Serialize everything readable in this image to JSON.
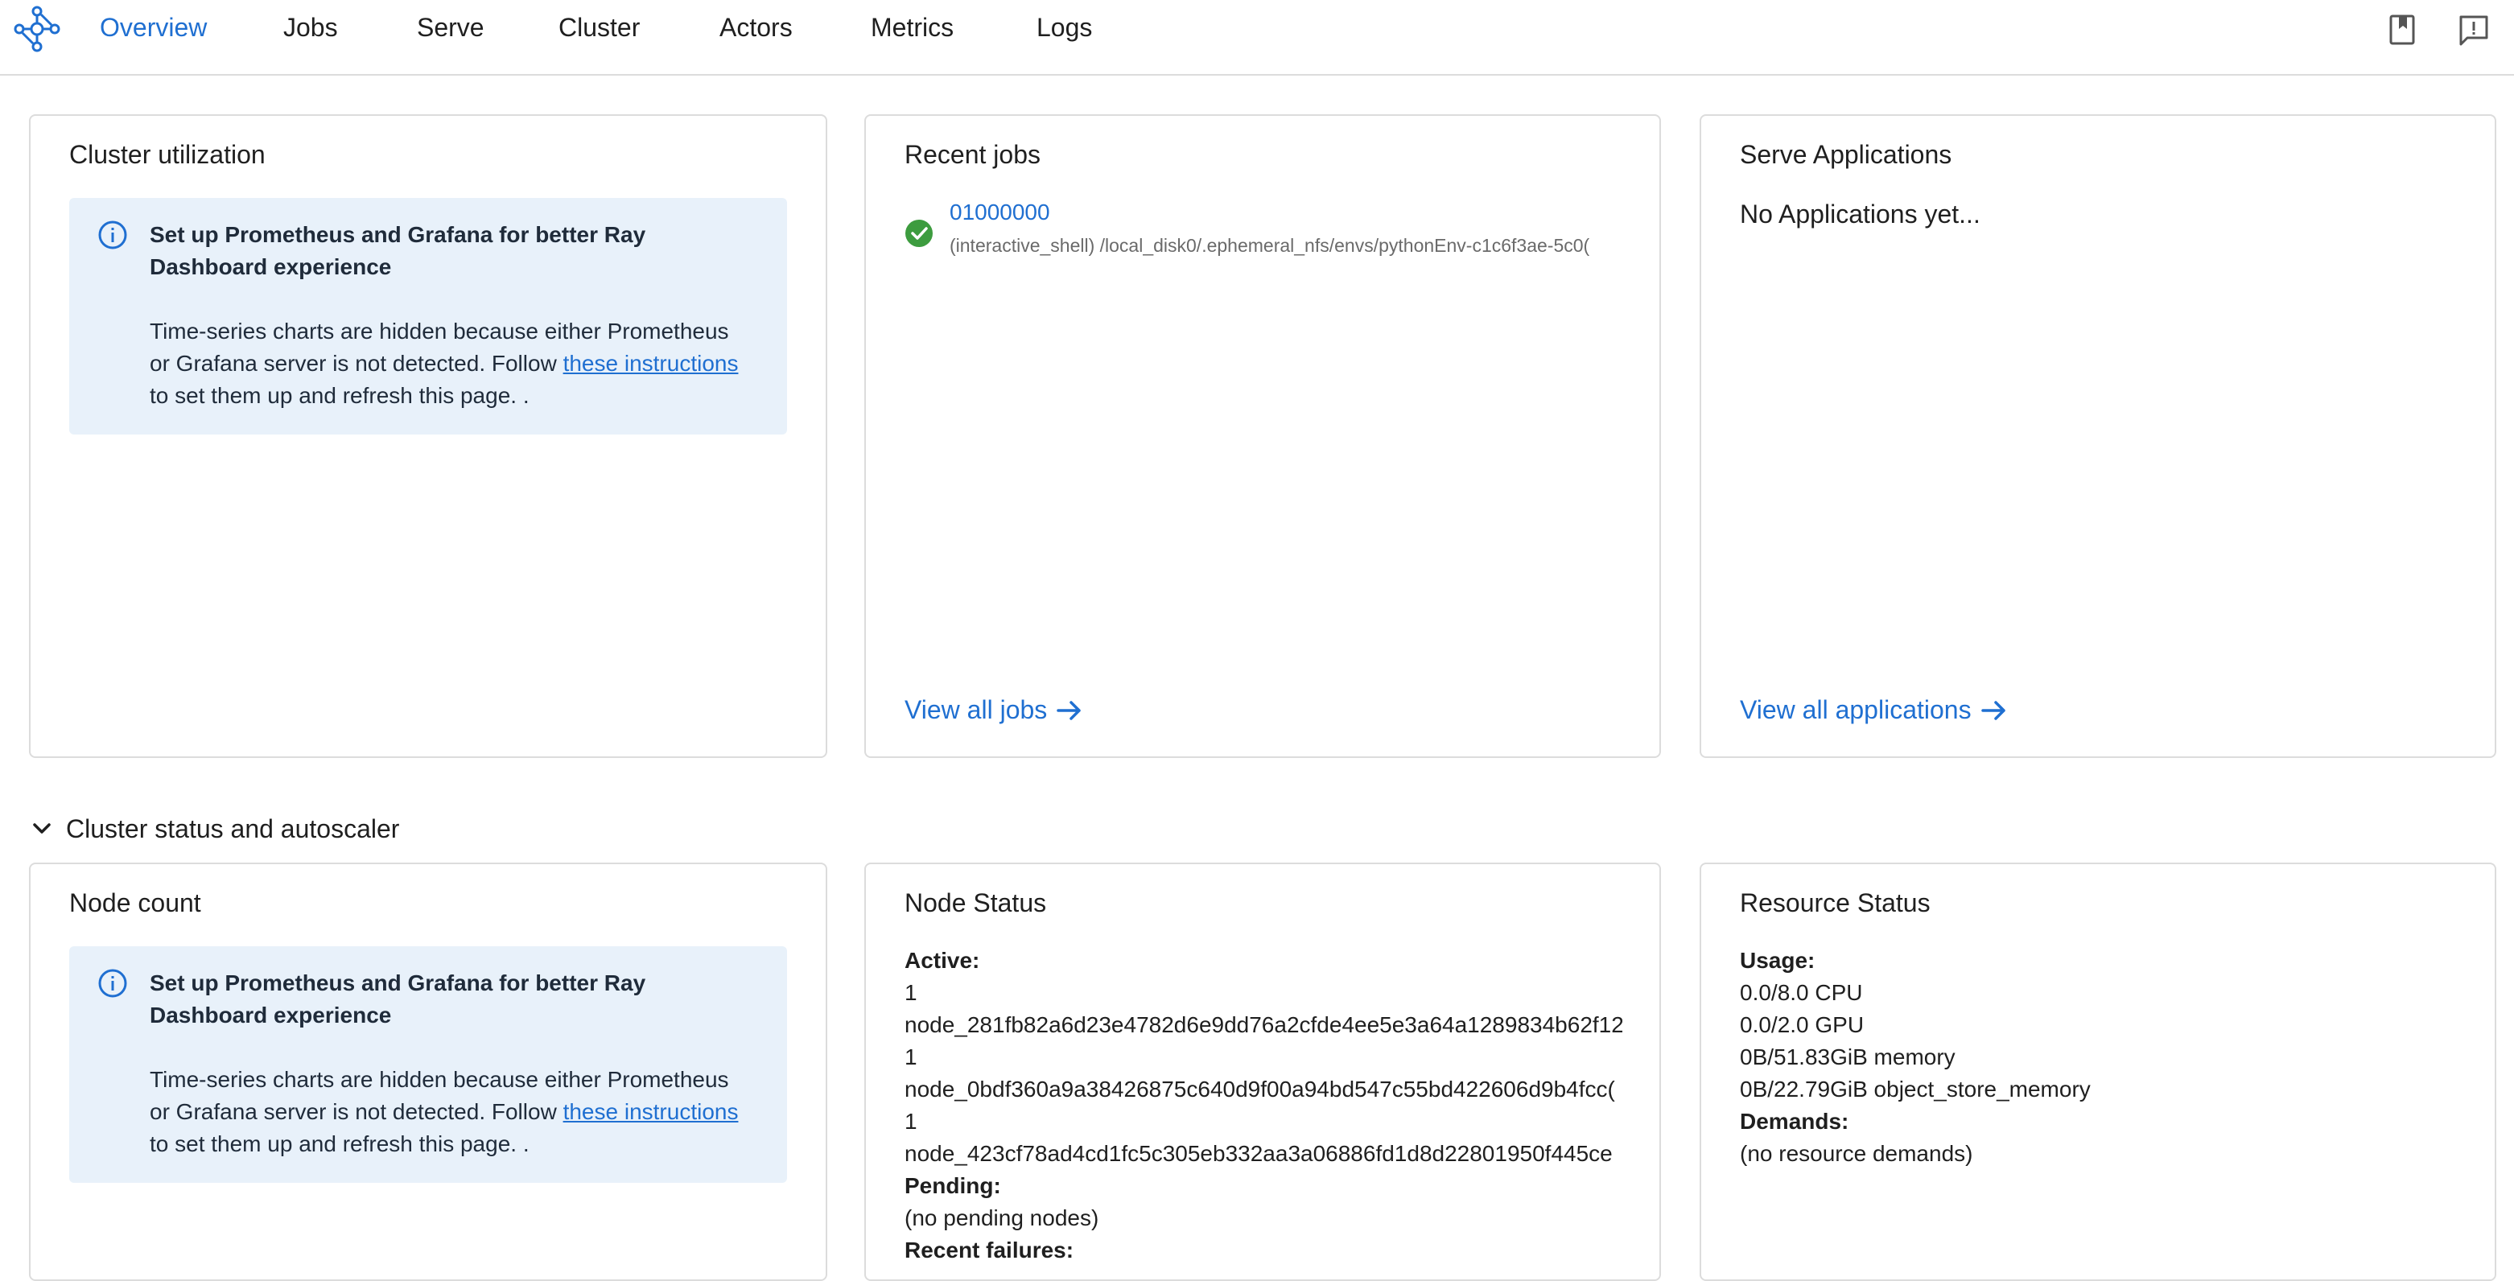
{
  "nav": {
    "items": [
      {
        "label": "Overview",
        "active": true
      },
      {
        "label": "Jobs"
      },
      {
        "label": "Serve"
      },
      {
        "label": "Cluster"
      },
      {
        "label": "Actors"
      },
      {
        "label": "Metrics"
      },
      {
        "label": "Logs"
      }
    ],
    "right_icons": [
      "book-icon",
      "feedback-icon"
    ]
  },
  "cluster_utilization": {
    "title": "Cluster utilization",
    "alert": {
      "title": "Set up Prometheus and Grafana for better Ray Dashboard experience",
      "body_before": "Time-series charts are hidden because either Prometheus or Grafana server is not detected. Follow ",
      "link": "these instructions",
      "body_after": " to set them up and refresh this page. ."
    }
  },
  "recent_jobs": {
    "title": "Recent jobs",
    "jobs": [
      {
        "id": "01000000",
        "status": "succeeded",
        "command": "(interactive_shell) /local_disk0/.ephemeral_nfs/envs/pythonEnv-c1c6f3ae-5c0("
      }
    ],
    "view_all": "View all jobs"
  },
  "serve_applications": {
    "title": "Serve Applications",
    "empty_text": "No Applications yet...",
    "view_all": "View all applications"
  },
  "section": {
    "label": "Cluster status and autoscaler"
  },
  "node_count": {
    "title": "Node count",
    "alert": {
      "title": "Set up Prometheus and Grafana for better Ray Dashboard experience",
      "body_before": "Time-series charts are hidden because either Prometheus or Grafana server is not detected. Follow ",
      "link": "these instructions",
      "body_after": " to set them up and refresh this page. ."
    }
  },
  "node_status": {
    "title": "Node Status",
    "active_label": "Active:",
    "active_nodes": [
      {
        "count": "1",
        "name": "node_281fb82a6d23e4782d6e9dd76a2cfde4ee5e3a64a1289834b62f12"
      },
      {
        "count": "1",
        "name": "node_0bdf360a9a38426875c640d9f00a94bd547c55bd422606d9b4fcc("
      },
      {
        "count": "1",
        "name": "node_423cf78ad4cd1fc5c305eb332aa3a06886fd1d8d22801950f445ce"
      }
    ],
    "pending_label": "Pending:",
    "pending_text": "(no pending nodes)",
    "failures_label": "Recent failures:"
  },
  "resource_status": {
    "title": "Resource Status",
    "usage_label": "Usage:",
    "usage": [
      "0.0/8.0 CPU",
      "0.0/2.0 GPU",
      "0B/51.83GiB memory",
      "0B/22.79GiB object_store_memory"
    ],
    "demands_label": "Demands:",
    "demands_text": "(no resource demands)"
  },
  "colors": {
    "accent": "#1f6fd1",
    "alert_bg": "#e8f1fa",
    "success": "#3d9c3f"
  }
}
